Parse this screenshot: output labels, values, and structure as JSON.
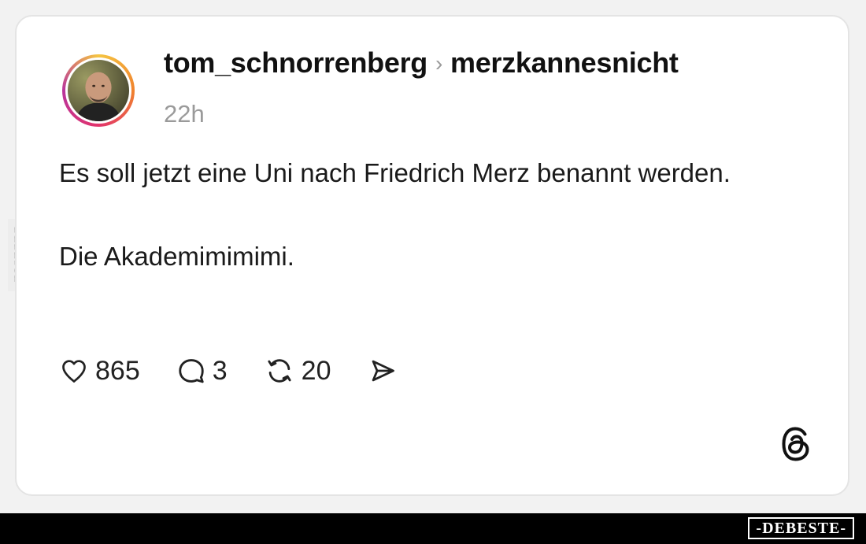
{
  "post": {
    "author": "tom_schnorrenberg",
    "recipient": "merzkannesnicht",
    "time": "22h",
    "paragraph1": "Es soll jetzt eine Uni nach Friedrich Merz benannt werden.",
    "paragraph2": "Die Akademimimimi."
  },
  "actions": {
    "likes": "865",
    "comments": "3",
    "reposts": "20"
  },
  "icons": {
    "like": "heart-icon",
    "comment": "comment-bubble-icon",
    "repost": "repost-icon",
    "share": "send-icon",
    "brand": "threads-logo-icon"
  },
  "watermark": {
    "side": "DEBESTE",
    "footer": "-DEBESTE-"
  },
  "colors": {
    "text": "#1a1a1a",
    "muted": "#9a9a9a",
    "card_border": "#e4e4e4",
    "footer_bg": "#000000"
  }
}
